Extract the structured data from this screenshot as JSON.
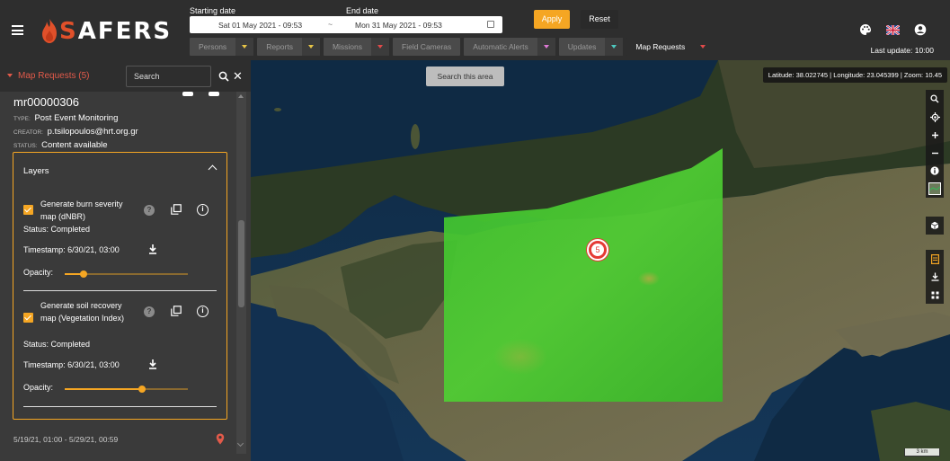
{
  "header": {
    "menu_icon": "hamburger-icon",
    "brand": "SAFERS",
    "starting_date_label": "Starting date",
    "end_date_label": "End date",
    "start_date_value": "Sat 01 May 2021 - 09:53",
    "date_separator": "~",
    "end_date_value": "Mon 31 May 2021 - 09:53",
    "apply_label": "Apply",
    "reset_label": "Reset",
    "filters": [
      {
        "label": "Persons",
        "accent": "#e8c547"
      },
      {
        "label": "Reports",
        "accent": "#e8c547"
      },
      {
        "label": "Missions",
        "accent": "#e04a4a"
      },
      {
        "label": "Field Cameras",
        "accent": ""
      },
      {
        "label": "Automatic Alerts",
        "accent": "#e07ad6"
      },
      {
        "label": "Updates",
        "accent": "#4ec9c0"
      },
      {
        "label": "Map Requests",
        "accent": "#e04a4a"
      }
    ],
    "last_update": "Last update: 10:00",
    "icons": [
      "palette-icon",
      "uk-flag-icon",
      "account-icon"
    ]
  },
  "side_panel": {
    "title": "Map Requests (5)",
    "search_placeholder": "Search",
    "card": {
      "id": "mr00000306",
      "type_key": "TYPE:",
      "type_value": "Post Event Monitoring",
      "creator_key": "CREATOR:",
      "creator_value": "p.tsilopoulos@hrt.org.gr",
      "status_key": "STATUS:",
      "status_value": "Content available",
      "layers_title": "Layers",
      "layers": [
        {
          "name": "Generate burn severity map (dNBR)",
          "status": "Status: Completed",
          "timestamp": "Timestamp: 6/30/21, 03:00",
          "opacity_label": "Opacity:",
          "opacity": 0.15,
          "checked": true
        },
        {
          "name": "Generate soil recovery map (Vegetation Index)",
          "status": "Status: Completed",
          "timestamp": "Timestamp: 6/30/21, 03:00",
          "opacity_label": "Opacity:",
          "opacity": 0.63,
          "checked": true
        }
      ],
      "date_range": "5/19/21, 01:00 - 5/29/21, 00:59"
    }
  },
  "map": {
    "search_area_label": "Search this area",
    "coords": "Latitude: 38.022745 | Longitude: 23.045399 | Zoom: 10.45",
    "cluster_count": "5",
    "scale_label": "3 km",
    "tool_icons": [
      "search-icon",
      "locate-icon",
      "zoom-in-icon",
      "zoom-out-icon",
      "info-icon",
      "layers-thumbnail-icon",
      "cube-icon",
      "legend-icon",
      "download-icon",
      "grid-icon"
    ]
  },
  "colors": {
    "accent": "#f5a623",
    "brand_red": "#e0502a",
    "panel_bg": "#3a3a3a",
    "header_bg": "#2e2e2e",
    "overlay_green": "#3fbf2e"
  }
}
